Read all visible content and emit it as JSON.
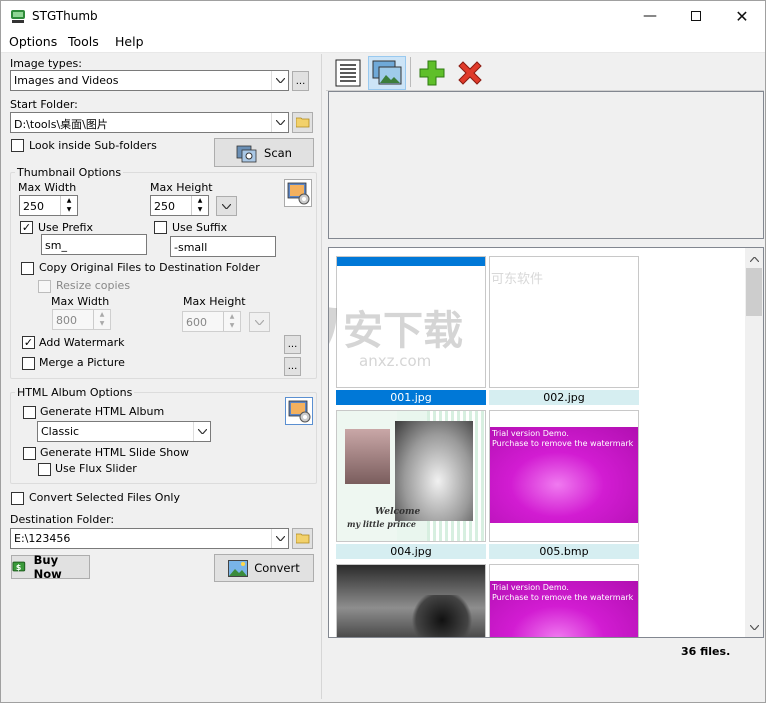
{
  "window": {
    "title": "STGThumb"
  },
  "menu": [
    "Options",
    "Tools",
    "Help"
  ],
  "left": {
    "image_types_label": "Image types:",
    "image_types_value": "Images and Videos",
    "ellipsis": "...",
    "start_folder_label": "Start Folder:",
    "start_folder_value": "D:\\tools\\桌面\\图片",
    "look_inside_label": "Look inside Sub-folders",
    "scan_label": "Scan",
    "thumb_group": "Thumbnail Options",
    "max_width_label": "Max Width",
    "max_height_label": "Max Height",
    "max_width_value": "250",
    "max_height_value": "250",
    "use_prefix_label": "Use Prefix",
    "prefix_value": "sm_",
    "use_suffix_label": "Use Suffix",
    "suffix_value": "-small",
    "copy_original_label": "Copy Original Files to Destination Folder",
    "resize_copies_label": "Resize copies",
    "copy_max_width_label": "Max Width",
    "copy_max_height_label": "Max Height",
    "copy_max_width_value": "800",
    "copy_max_height_value": "600",
    "add_watermark_label": "Add Watermark",
    "merge_picture_label": "Merge a Picture",
    "html_group": "HTML Album Options",
    "generate_html_label": "Generate HTML Album",
    "html_style_value": "Classic",
    "generate_slideshow_label": "Generate HTML Slide Show",
    "flux_label": "Use Flux Slider",
    "convert_selected_label": "Convert Selected Files Only",
    "dest_folder_label": "Destination Folder:",
    "dest_folder_value": "E:\\123456",
    "buy_now_label": "Buy Now",
    "convert_label": "Convert"
  },
  "right": {
    "thumbnails": [
      {
        "name": "001.jpg",
        "selected": true
      },
      {
        "name": "002.jpg",
        "selected": false
      },
      {
        "name": "004.jpg",
        "selected": false
      },
      {
        "name": "005.bmp",
        "selected": false
      }
    ],
    "thumb_texts": {
      "watermark_cn": "可东软件",
      "trial": "Trial version Demo.",
      "purchase": "Purchase to remove the watermark",
      "welcome": "Welcome",
      "prince": "my little prince"
    },
    "overlay_logo_text": "安下载",
    "overlay_logo_url": "anxz.com",
    "file_count": "36 files."
  },
  "colors": {
    "accent": "#0078d7",
    "caption": "#d6eef1",
    "magenta": "#d21cd2"
  }
}
